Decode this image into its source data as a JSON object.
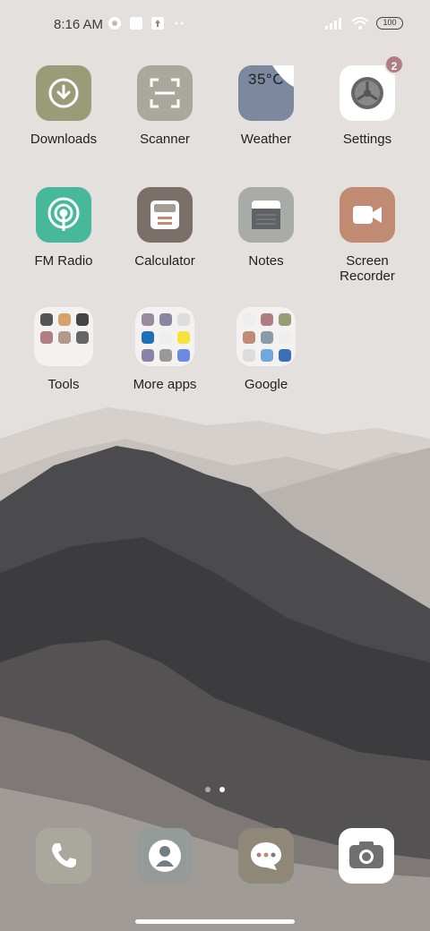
{
  "status_bar": {
    "time": "8:16 AM",
    "battery": "100"
  },
  "apps": [
    {
      "label": "Downloads",
      "icon": "download-icon",
      "color": "#9a9c78"
    },
    {
      "label": "Scanner",
      "icon": "scan-icon",
      "color": "#aaa79d"
    },
    {
      "label": "Weather",
      "icon": "weather-icon",
      "color": "#7c87a0",
      "text": "35°C"
    },
    {
      "label": "Settings",
      "icon": "gear-icon",
      "color": "#ffffff",
      "badge": "2"
    },
    {
      "label": "FM Radio",
      "icon": "radio-icon",
      "color": "#47b89a"
    },
    {
      "label": "Calculator",
      "icon": "calculator-icon",
      "color": "#7b6f69"
    },
    {
      "label": "Notes",
      "icon": "notes-icon",
      "color": "#a8aba8"
    },
    {
      "label": "Screen Recorder",
      "icon": "video-camera-icon",
      "color": "#c18a73"
    }
  ],
  "folders": [
    {
      "label": "Tools"
    },
    {
      "label": "More apps"
    },
    {
      "label": "Google"
    }
  ],
  "dock": [
    {
      "icon": "phone-icon",
      "color": "#aaa79d"
    },
    {
      "icon": "contact-icon",
      "color": "#959b98"
    },
    {
      "icon": "message-icon",
      "color": "#8f8878"
    },
    {
      "icon": "camera-icon",
      "color": "#ffffff"
    }
  ],
  "page_indicator": {
    "pages": 2,
    "active": 2
  }
}
